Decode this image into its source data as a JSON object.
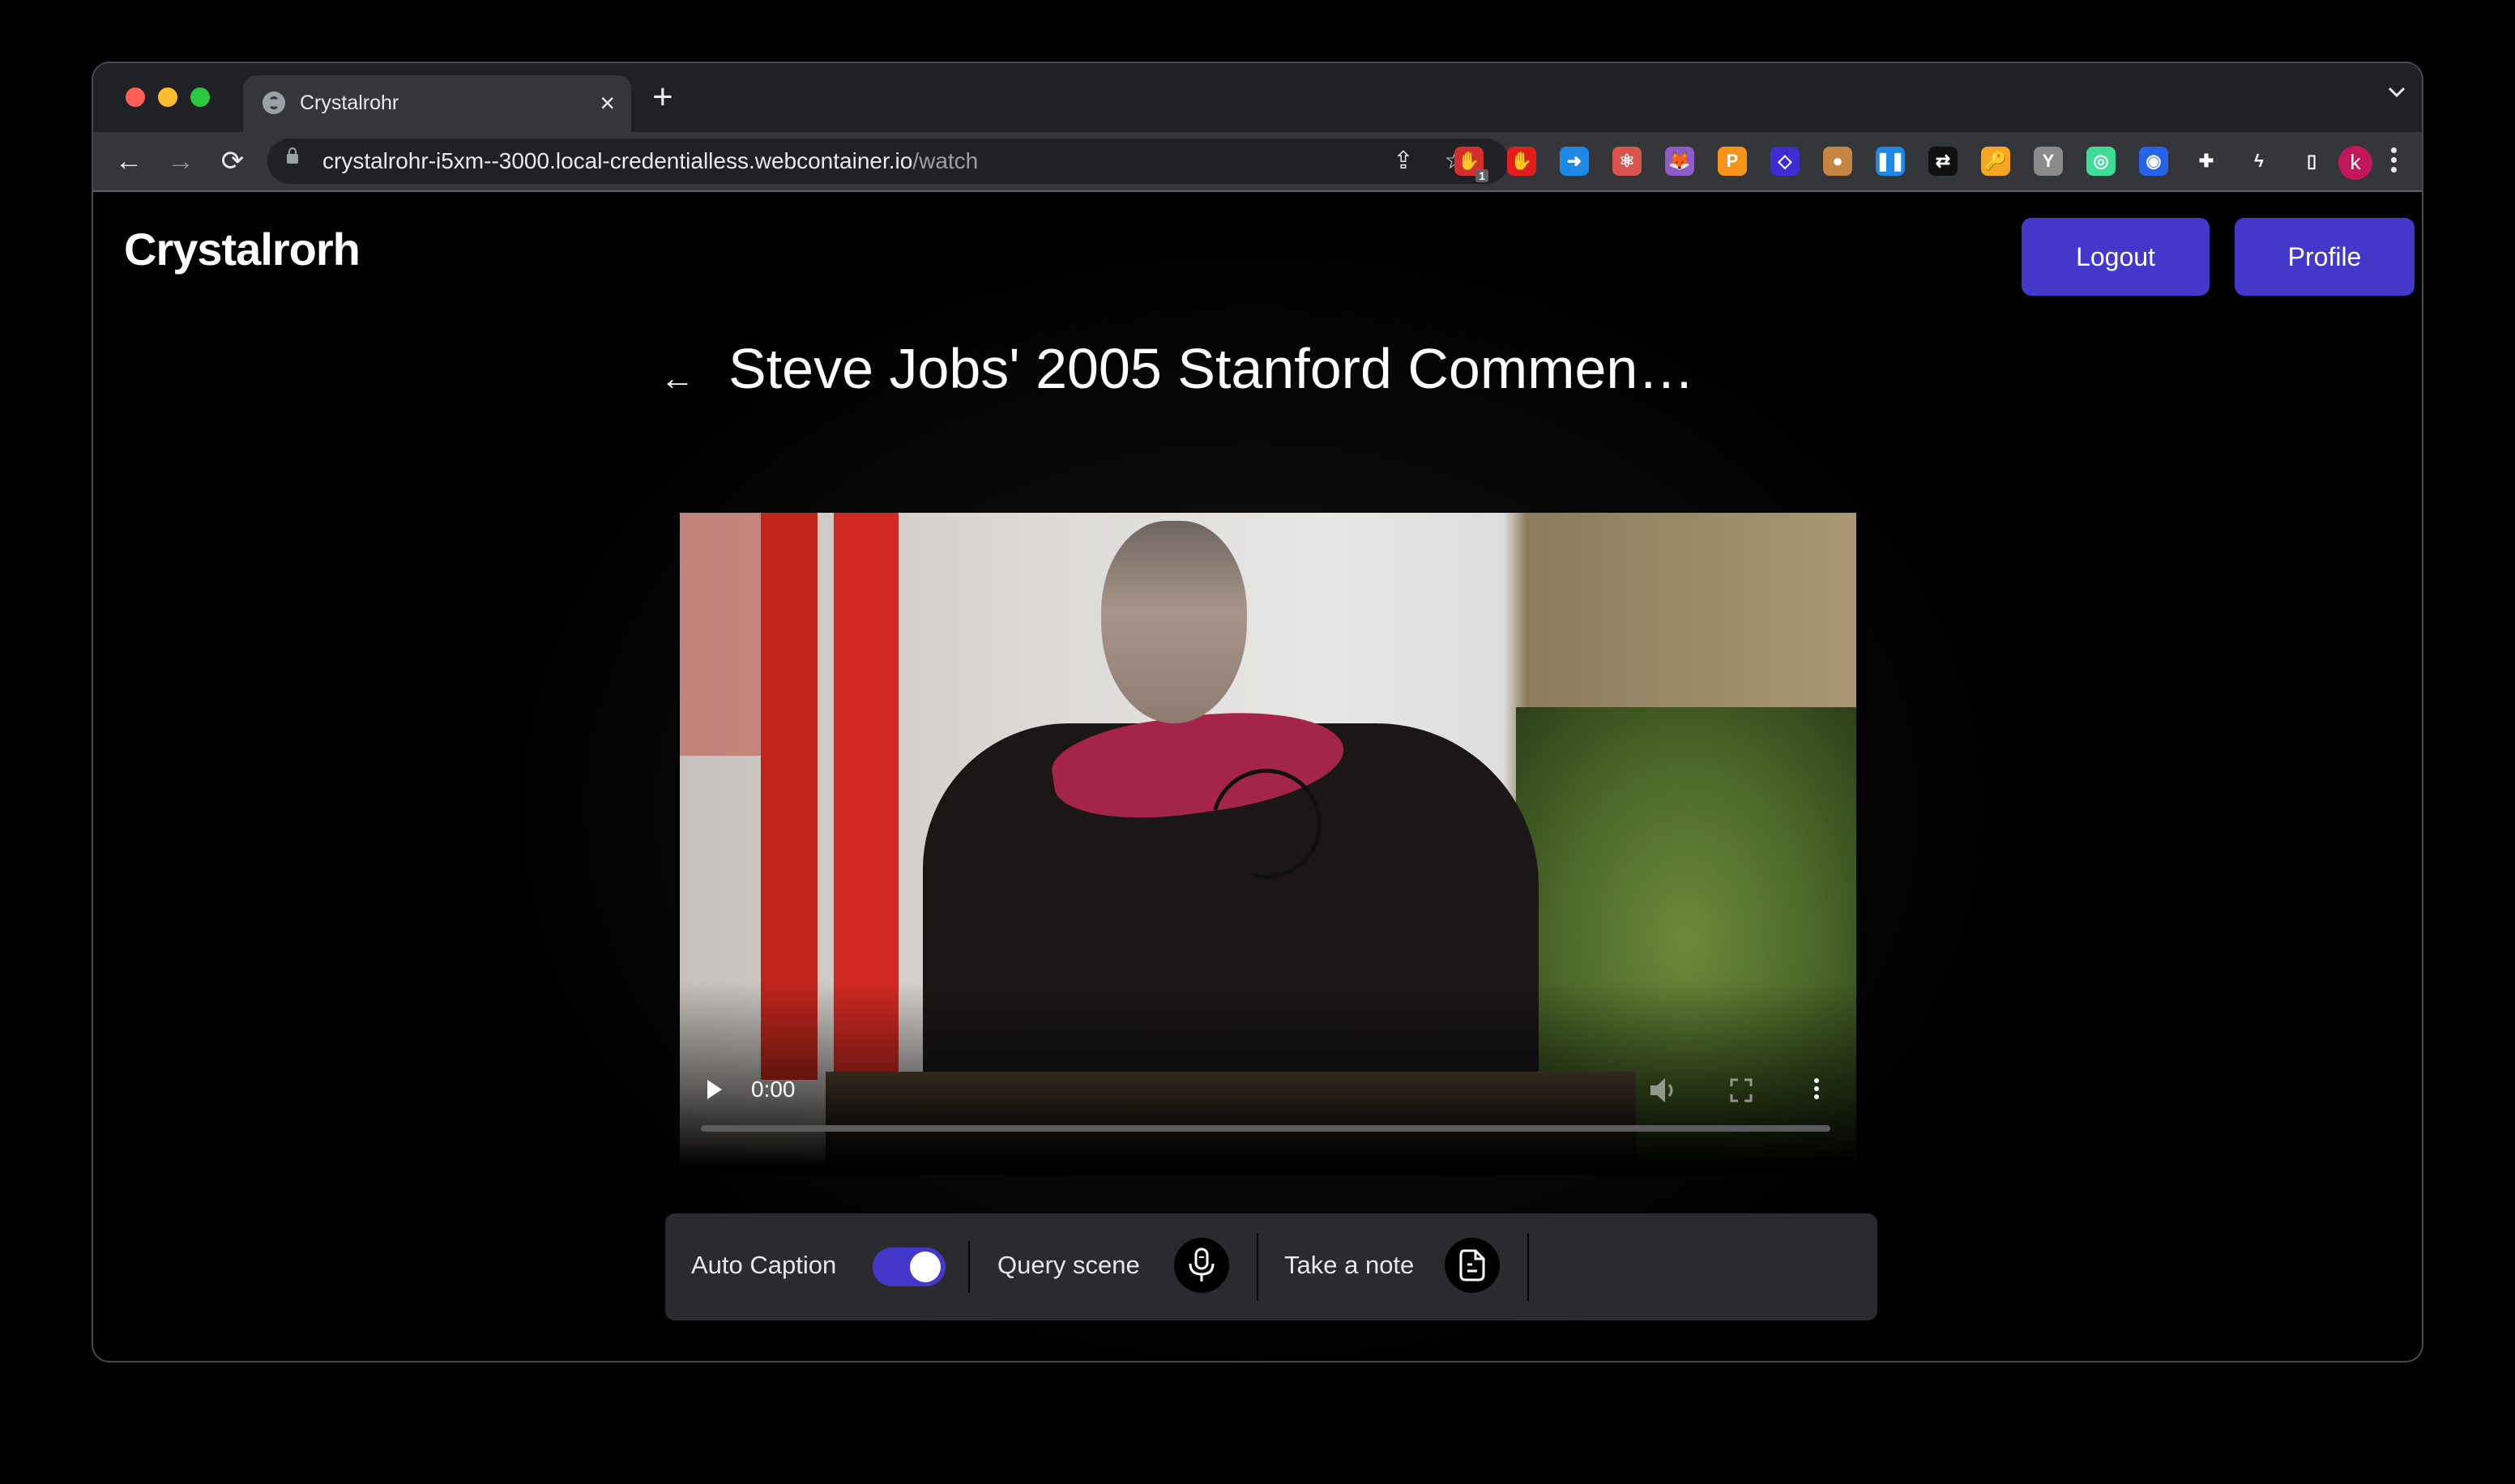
{
  "browser": {
    "tab": {
      "title": "Crystalrohr",
      "icon": "globe-icon"
    },
    "new_tab_symbol": "+",
    "close_tab_symbol": "×",
    "tab_menu_icon": "chevron-down-icon",
    "nav": {
      "back": "←",
      "forward": "→",
      "reload": "⟳"
    },
    "url": {
      "host": "crystalrohr-i5xm--3000.local-credentialless.webcontainer.io",
      "path": "/watch"
    },
    "omnibox_icons": [
      "share-icon",
      "bookmark-star-icon"
    ],
    "omnibox_glyphs": {
      "share": "⇪",
      "star": "☆"
    },
    "extensions": [
      {
        "name": "adblock-extension-icon",
        "color": "#d32f2f",
        "glyph": "✋",
        "badge": "1"
      },
      {
        "name": "ublock-extension-icon",
        "color": "#e11d1d",
        "glyph": "✋"
      },
      {
        "name": "sidebar-arrow-extension-icon",
        "color": "#1e88e5",
        "glyph": "➜"
      },
      {
        "name": "react-devtools-extension-icon",
        "color": "#d9534f",
        "glyph": "⚛"
      },
      {
        "name": "metamask-extension-icon",
        "color": "#8e5cc9",
        "glyph": "🦊"
      },
      {
        "name": "polkadot-extension-icon",
        "color": "#f7931a",
        "glyph": "P"
      },
      {
        "name": "diamond-extension-icon",
        "color": "#3f2bd1",
        "glyph": "◇"
      },
      {
        "name": "cookie-extension-icon",
        "color": "#c68642",
        "glyph": "●"
      },
      {
        "name": "pause-extension-icon",
        "color": "#1e88e5",
        "glyph": "❚❚"
      },
      {
        "name": "sync-extension-icon",
        "color": "#111111",
        "glyph": "⇄"
      },
      {
        "name": "key-extension-icon",
        "color": "#f5a623",
        "glyph": "🔑"
      },
      {
        "name": "y-extension-icon",
        "color": "#8a8a8a",
        "glyph": "Y"
      },
      {
        "name": "target-extension-icon",
        "color": "#3ddc97",
        "glyph": "◎"
      },
      {
        "name": "screen-extension-icon",
        "color": "#2563eb",
        "glyph": "◉"
      },
      {
        "name": "puzzle-extensions-icon",
        "color": "#35363a",
        "glyph": "✚"
      },
      {
        "name": "bolt-extension-icon",
        "color": "#35363a",
        "glyph": "ϟ"
      },
      {
        "name": "sidepanel-icon",
        "color": "#35363a",
        "glyph": "▯"
      }
    ],
    "profile_initial": "k",
    "profile_color": "#c2185b"
  },
  "app": {
    "logo": "Crystalrorh",
    "buttons": {
      "logout": "Logout",
      "profile": "Profile"
    },
    "accent_color": "#4338ca",
    "back_arrow": "←",
    "video_title": "Steve Jobs' 2005 Stanford Commen…",
    "player": {
      "time": "0:00",
      "progress": 0,
      "state": "loading"
    },
    "controls": {
      "auto_caption": {
        "label": "Auto Caption",
        "enabled": true
      },
      "query_scene": {
        "label": "Query scene",
        "icon": "microphone-icon"
      },
      "take_note": {
        "label": "Take a note",
        "icon": "note-document-icon"
      }
    }
  }
}
